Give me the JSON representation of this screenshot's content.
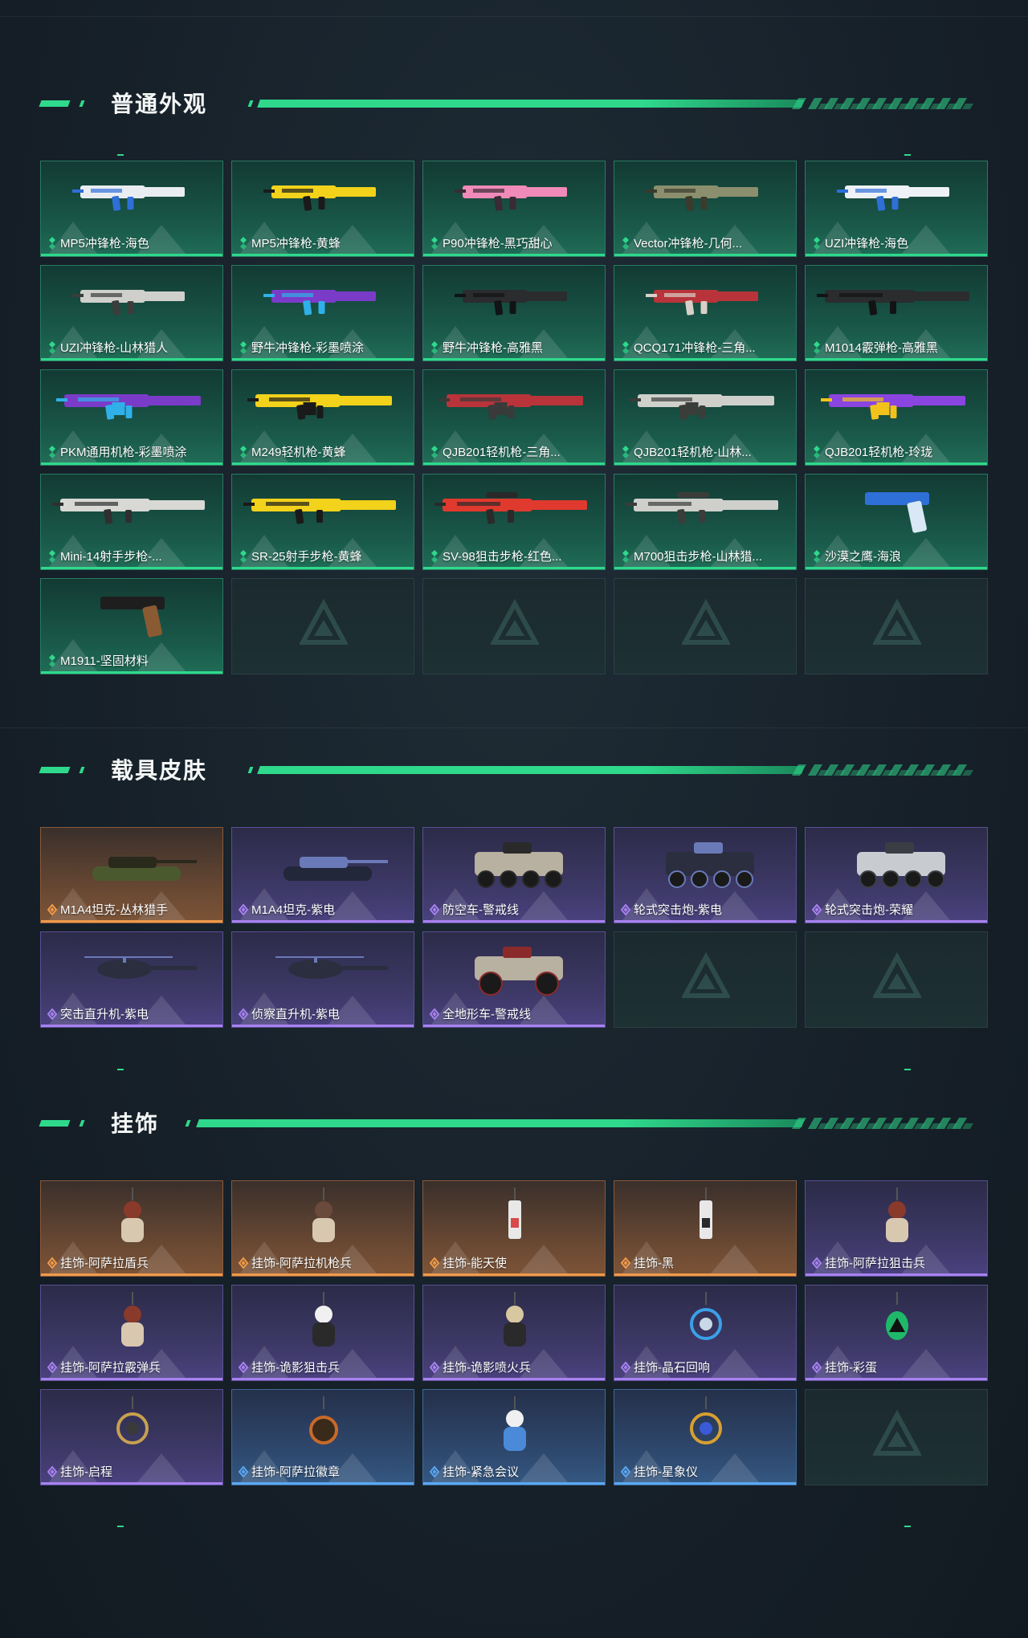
{
  "sections": [
    {
      "title": "普通外观",
      "items": [
        {
          "label": "MP5冲锋枪-海色",
          "tier": "green",
          "icon": "smg-icon",
          "colors": [
            "#e9edf2",
            "#2f6fd8"
          ]
        },
        {
          "label": "MP5冲锋枪-黄蜂",
          "tier": "green",
          "icon": "smg-icon",
          "colors": [
            "#f2d21b",
            "#1a1a1a"
          ]
        },
        {
          "label": "P90冲锋枪-黑巧甜心",
          "tier": "green",
          "icon": "smg-icon",
          "colors": [
            "#f08ab8",
            "#3a2a33"
          ]
        },
        {
          "label": "Vector冲锋枪-几何...",
          "tier": "green",
          "icon": "smg-icon",
          "colors": [
            "#8b8f6e",
            "#3b3b2c"
          ]
        },
        {
          "label": "UZI冲锋枪-海色",
          "tier": "green",
          "icon": "smg-icon",
          "colors": [
            "#eef2f6",
            "#2f6fd8"
          ]
        },
        {
          "label": "UZI冲锋枪-山林猎人",
          "tier": "green",
          "icon": "smg-icon",
          "colors": [
            "#cfd0cc",
            "#3b3d3b"
          ]
        },
        {
          "label": "野牛冲锋枪-彩墨喷涂",
          "tier": "green",
          "icon": "smg-icon",
          "colors": [
            "#7a3cc8",
            "#2fb0e8"
          ]
        },
        {
          "label": "野牛冲锋枪-高雅黑",
          "tier": "green",
          "icon": "smg-icon",
          "colors": [
            "#2a2c2e",
            "#111315"
          ]
        },
        {
          "label": "QCQ171冲锋枪-三角...",
          "tier": "green",
          "icon": "smg-icon",
          "colors": [
            "#b8343a",
            "#d8d0c8"
          ]
        },
        {
          "label": "M1014霰弹枪-高雅黑",
          "tier": "green",
          "icon": "shotgun-icon",
          "colors": [
            "#2a2c2e",
            "#111315"
          ]
        },
        {
          "label": "PKM通用机枪-彩墨喷涂",
          "tier": "green",
          "icon": "machinegun-icon",
          "colors": [
            "#7a3cc8",
            "#2fb0e8"
          ]
        },
        {
          "label": "M249轻机枪-黄蜂",
          "tier": "green",
          "icon": "machinegun-icon",
          "colors": [
            "#f2d21b",
            "#1a1a1a"
          ]
        },
        {
          "label": "QJB201轻机枪-三角...",
          "tier": "green",
          "icon": "machinegun-icon",
          "colors": [
            "#b8343a",
            "#3a3a3a"
          ]
        },
        {
          "label": "QJB201轻机枪-山林...",
          "tier": "green",
          "icon": "machinegun-icon",
          "colors": [
            "#cfd0cc",
            "#3b3d3b"
          ]
        },
        {
          "label": "QJB201轻机枪-玲珑",
          "tier": "green",
          "icon": "machinegun-icon",
          "colors": [
            "#8a44e0",
            "#f2c21b"
          ]
        },
        {
          "label": "Mini-14射手步枪-...",
          "tier": "green",
          "icon": "rifle-icon",
          "colors": [
            "#d8d8d4",
            "#2f2f2f"
          ]
        },
        {
          "label": "SR-25射手步枪-黄蜂",
          "tier": "green",
          "icon": "rifle-icon",
          "colors": [
            "#f2d21b",
            "#1a1a1a"
          ]
        },
        {
          "label": "SV-98狙击步枪-红色...",
          "tier": "green",
          "icon": "sniper-icon",
          "colors": [
            "#e0392e",
            "#2a2a2a"
          ]
        },
        {
          "label": "M700狙击步枪-山林猎...",
          "tier": "green",
          "icon": "sniper-icon",
          "colors": [
            "#cfd0cc",
            "#3b3d3b"
          ]
        },
        {
          "label": "沙漠之鹰-海浪",
          "tier": "green",
          "icon": "pistol-icon",
          "colors": [
            "#2f6fd8",
            "#d9e8f5"
          ]
        },
        {
          "label": "M1911-坚固材料",
          "tier": "green",
          "icon": "pistol-icon",
          "colors": [
            "#1e1e1e",
            "#8a5a33"
          ]
        },
        {
          "label": "",
          "tier": "empty",
          "icon": "placeholder-logo-icon",
          "colors": []
        },
        {
          "label": "",
          "tier": "empty",
          "icon": "placeholder-logo-icon",
          "colors": []
        },
        {
          "label": "",
          "tier": "empty",
          "icon": "placeholder-logo-icon",
          "colors": []
        },
        {
          "label": "",
          "tier": "empty",
          "icon": "placeholder-logo-icon",
          "colors": []
        }
      ]
    },
    {
      "title": "载具皮肤",
      "items": [
        {
          "label": "M1A4坦克-丛林猎手",
          "tier": "orange",
          "icon": "tank-icon",
          "colors": [
            "#4a5a2e",
            "#2a2a1c"
          ]
        },
        {
          "label": "M1A4坦克-紫电",
          "tier": "purple",
          "icon": "tank-icon",
          "colors": [
            "#23273a",
            "#6a7ab8"
          ]
        },
        {
          "label": "防空车-警戒线",
          "tier": "purple",
          "icon": "apc-icon",
          "colors": [
            "#b8b0a0",
            "#2a2a2a"
          ]
        },
        {
          "label": "轮式突击炮-紫电",
          "tier": "purple",
          "icon": "apc-icon",
          "colors": [
            "#2a2e3e",
            "#6a7ab8"
          ]
        },
        {
          "label": "轮式突击炮-荣耀",
          "tier": "purple",
          "icon": "apc-icon",
          "colors": [
            "#c8ccd0",
            "#3a3e44"
          ]
        },
        {
          "label": "突击直升机-紫电",
          "tier": "purple",
          "icon": "helicopter-icon",
          "colors": [
            "#2a2e3e",
            "#6a7ab8"
          ]
        },
        {
          "label": "侦察直升机-紫电",
          "tier": "purple",
          "icon": "helicopter-icon",
          "colors": [
            "#2a2e3e",
            "#6a7ab8"
          ]
        },
        {
          "label": "全地形车-警戒线",
          "tier": "purple",
          "icon": "atv-icon",
          "colors": [
            "#b8b0a0",
            "#8a2a2a"
          ]
        },
        {
          "label": "",
          "tier": "empty",
          "icon": "placeholder-logo-icon",
          "colors": []
        },
        {
          "label": "",
          "tier": "empty",
          "icon": "placeholder-logo-icon",
          "colors": []
        }
      ]
    },
    {
      "title": "挂饰",
      "items": [
        {
          "label": "挂饰-阿萨拉盾兵",
          "tier": "orange",
          "icon": "charm-figure-icon",
          "colors": [
            "#8a3a2a",
            "#d8c8b0"
          ]
        },
        {
          "label": "挂饰-阿萨拉机枪兵",
          "tier": "orange",
          "icon": "charm-figure-icon",
          "colors": [
            "#6a4a3a",
            "#d8c8b0"
          ]
        },
        {
          "label": "挂饰-能天使",
          "tier": "orange",
          "icon": "charm-tag-icon",
          "colors": [
            "#e8e8e8",
            "#d84a4a"
          ]
        },
        {
          "label": "挂饰-黑",
          "tier": "orange",
          "icon": "charm-tag-icon",
          "colors": [
            "#e8e8e8",
            "#2a2a2a"
          ]
        },
        {
          "label": "挂饰-阿萨拉狙击兵",
          "tier": "purple",
          "icon": "charm-figure-icon",
          "colors": [
            "#8a3a2a",
            "#d8c8b0"
          ]
        },
        {
          "label": "挂饰-阿萨拉霰弹兵",
          "tier": "purple",
          "icon": "charm-figure-icon",
          "colors": [
            "#8a3a2a",
            "#d8c8b0"
          ]
        },
        {
          "label": "挂饰-诡影狙击兵",
          "tier": "purple",
          "icon": "charm-mask-icon",
          "colors": [
            "#f0f0f0",
            "#2a2a2a"
          ]
        },
        {
          "label": "挂饰-诡影喷火兵",
          "tier": "purple",
          "icon": "charm-mask-icon",
          "colors": [
            "#d8c8a0",
            "#2a2a2a"
          ]
        },
        {
          "label": "挂饰-晶石回响",
          "tier": "purple",
          "icon": "charm-crystal-icon",
          "colors": [
            "#3aa0e8",
            "#c8d8e8"
          ]
        },
        {
          "label": "挂饰-彩蛋",
          "tier": "purple",
          "icon": "charm-egg-icon",
          "colors": [
            "#1fb86a",
            "#111111"
          ]
        },
        {
          "label": "挂饰-启程",
          "tier": "purple",
          "icon": "charm-ring-icon",
          "colors": [
            "#c8a050",
            "#3a3a3a"
          ]
        },
        {
          "label": "挂饰-阿萨拉徽章",
          "tier": "blue",
          "icon": "charm-badge-icon",
          "colors": [
            "#c86a2a",
            "#3a2a1a"
          ]
        },
        {
          "label": "挂饰-紧急会议",
          "tier": "blue",
          "icon": "charm-figure-icon",
          "colors": [
            "#f0f0f0",
            "#4a8ad8"
          ]
        },
        {
          "label": "挂饰-星象仪",
          "tier": "blue",
          "icon": "charm-ring-icon",
          "colors": [
            "#d8a030",
            "#3a5ad8"
          ]
        },
        {
          "label": "",
          "tier": "empty",
          "icon": "placeholder-logo-icon",
          "colors": []
        }
      ]
    }
  ],
  "tier_colors": {
    "green": "#2fd98c",
    "orange": "#f09a4a",
    "purple": "#a882f0",
    "blue": "#5aa8f5"
  }
}
